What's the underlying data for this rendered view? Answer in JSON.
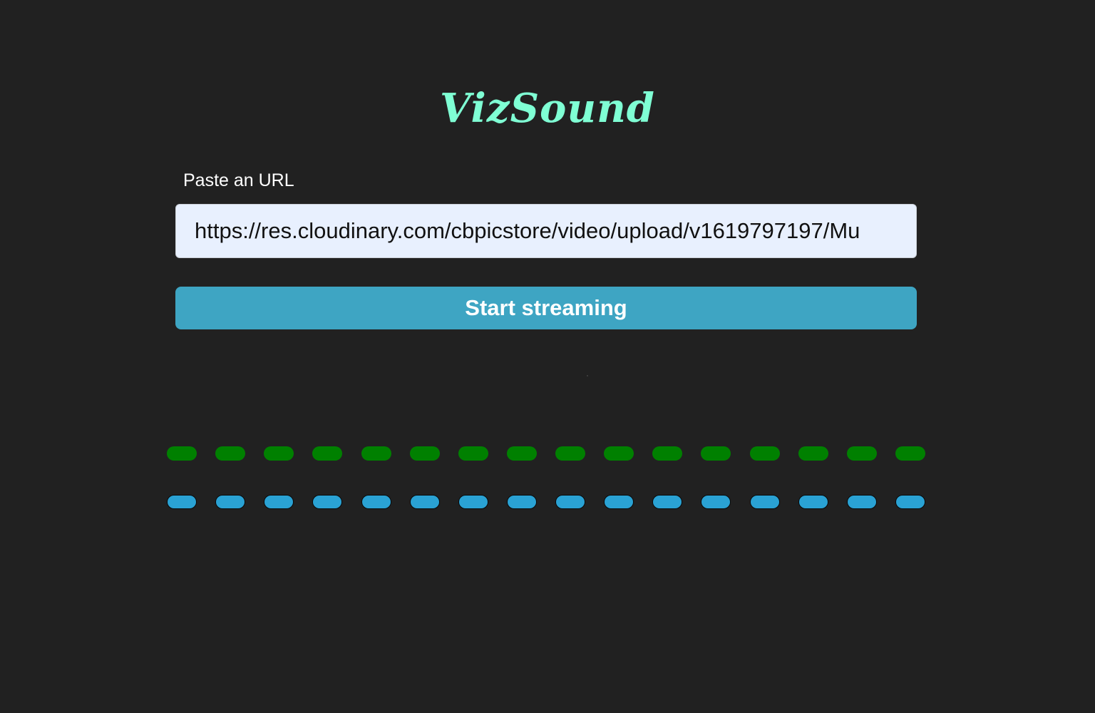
{
  "app": {
    "title": "VizSound"
  },
  "form": {
    "url_label": "Paste an URL",
    "url_value": "https://res.cloudinary.com/cbpicstore/video/upload/v1619797197/Mu",
    "start_label": "Start streaming"
  },
  "visualizer": {
    "bar_count": 16,
    "rows": [
      {
        "name": "green-row",
        "color": "#008000",
        "levels": [
          0,
          0,
          0,
          0,
          0,
          0,
          0,
          0,
          0,
          0,
          0,
          0,
          0,
          0,
          0,
          0
        ]
      },
      {
        "name": "blue-row",
        "color": "#2aa2d4",
        "levels": [
          0,
          0,
          0,
          0,
          0,
          0,
          0,
          0,
          0,
          0,
          0,
          0,
          0,
          0,
          0,
          0
        ]
      }
    ]
  },
  "colors": {
    "background": "#212121",
    "title": "#7fffd4",
    "button": "#3ea5c3",
    "input_background": "#e8f0fe"
  }
}
